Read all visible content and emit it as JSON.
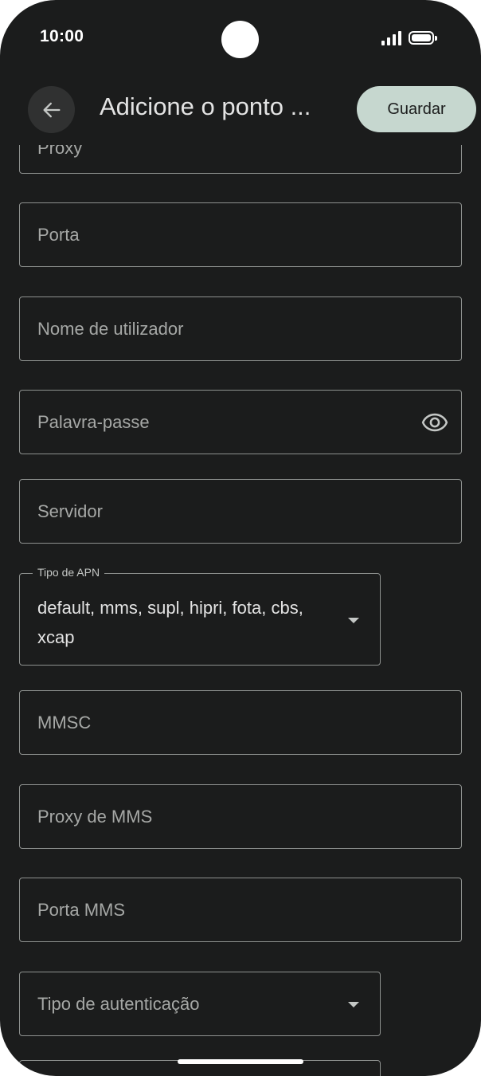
{
  "status_bar": {
    "time": "10:00"
  },
  "header": {
    "title": "Adicione o ponto ...",
    "save_label": "Guardar"
  },
  "form": {
    "proxy_placeholder": "Proxy",
    "port_placeholder": "Porta",
    "username_placeholder": "Nome de utilizador",
    "password_placeholder": "Palavra-passe",
    "server_placeholder": "Servidor",
    "apn_type": {
      "label": "Tipo de APN",
      "value": "default, mms, supl, hipri, fota, cbs, xcap"
    },
    "mmsc_placeholder": "MMSC",
    "mms_proxy_placeholder": "Proxy de MMS",
    "mms_port_placeholder": "Porta MMS",
    "auth_type_placeholder": "Tipo de autenticação"
  },
  "icons": {
    "back": "arrow-back-icon",
    "visibility": "eye-icon",
    "dropdown": "triangle-down-icon"
  },
  "colors": {
    "background": "#1b1c1c",
    "save_button": "#c6d7cf",
    "outline": "#8e918f"
  }
}
